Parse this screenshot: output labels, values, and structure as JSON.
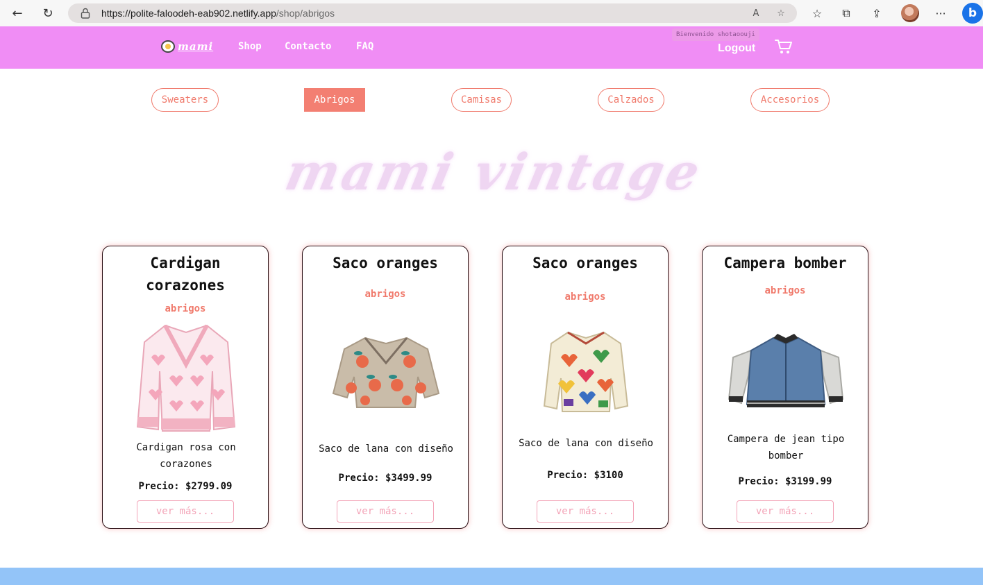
{
  "browser": {
    "url_host": "https://polite-faloodeh-eab902.netlify.app",
    "url_path": "/shop/abrigos",
    "back_icon": "←",
    "reload_icon": "↻",
    "read_aloud_icon": "A",
    "fav_add_icon": "☆",
    "favorites_icon": "☆",
    "collections_icon": "⧉",
    "share_icon": "⇪",
    "more_icon": "···",
    "bing_label": "b"
  },
  "header": {
    "logo_text": "mami",
    "nav": [
      "Shop",
      "Contacto",
      "FAQ"
    ],
    "welcome": "Bienvenido shotaoouji",
    "logout": "Logout"
  },
  "categories": [
    {
      "label": "Sweaters",
      "active": false
    },
    {
      "label": "Abrigos",
      "active": true
    },
    {
      "label": "Camisas",
      "active": false
    },
    {
      "label": "Calzados",
      "active": false
    },
    {
      "label": "Accesorios",
      "active": false
    }
  ],
  "hero": "mami vintage",
  "products": [
    {
      "title_lines": [
        "Cardigan",
        "corazones"
      ],
      "category": "abrigos",
      "desc_lines": [
        "Cardigan rosa con",
        "corazones"
      ],
      "price_label": "Precio:",
      "price": "$2799.09",
      "button": "ver más..."
    },
    {
      "title_lines": [
        "Saco oranges"
      ],
      "category": "abrigos",
      "desc_lines": [
        "Saco de lana con diseño"
      ],
      "price_label": "Precio:",
      "price": "$3499.99",
      "button": "ver más..."
    },
    {
      "title_lines": [
        "Saco oranges"
      ],
      "category": "abrigos",
      "desc_lines": [
        "Saco de lana con diseño"
      ],
      "price_label": "Precio:",
      "price": "$3100",
      "button": "ver más..."
    },
    {
      "title_lines": [
        "Campera bomber"
      ],
      "category": "abrigos",
      "desc_lines": [
        "Campera de jean tipo",
        "bomber"
      ],
      "price_label": "Precio:",
      "price": "$3199.99",
      "button": "ver más..."
    }
  ],
  "colors": {
    "header_bg": "#f08df5",
    "accent": "#f07a6c",
    "button_pink": "#f3a3b7",
    "footer": "#93c4f8",
    "hero": "#efd6f2"
  }
}
